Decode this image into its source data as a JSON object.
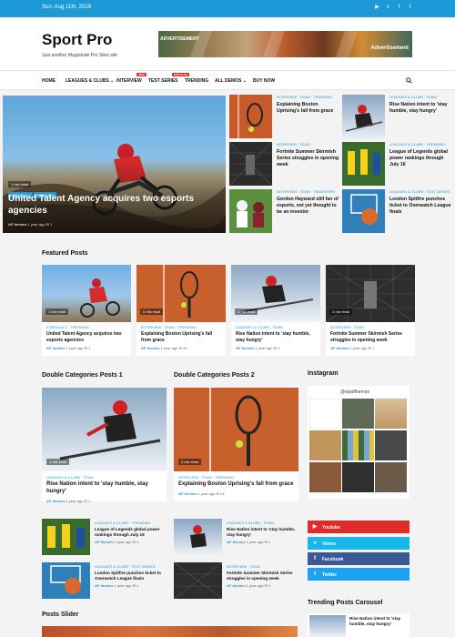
{
  "topbar": {
    "date": "Sun. Aug 11th, 2019",
    "icons": [
      "youtube-icon",
      "vimeo-icon",
      "facebook-icon",
      "twitter-icon"
    ]
  },
  "brand": {
    "title": "Sport Pro",
    "tagline": "Just another Magnitude Pro Sites site"
  },
  "ad": {
    "label_left": "ADVERTISEMENT",
    "label_right": "Advertisement"
  },
  "nav": [
    {
      "label": "HOME"
    },
    {
      "label": "LEAGUES & CLUBS",
      "dropdown": true
    },
    {
      "label": "INTERVIEW",
      "badge": "NEW",
      "badge_color": "#e02b2b"
    },
    {
      "label": "TEST SERIES",
      "badge": "POPULAR",
      "badge_color": "#e02b2b"
    },
    {
      "label": "TRENDING"
    },
    {
      "label": "ALL DEMOS",
      "dropdown": true
    },
    {
      "label": "BUY NOW"
    }
  ],
  "hero": {
    "read": "1 min read",
    "tags": [
      "FORMULA 2",
      "TRENDING"
    ],
    "title": "United Talent Agency acquires two esports agencies",
    "author": "AF themes",
    "ago": "1 year ago",
    "comments": "1"
  },
  "grid": [
    {
      "tags": "INTERVIEW · TEAM · TRENDING",
      "title": "Explaining Boston Uprising's fall from grace"
    },
    {
      "tags": "LEAGUES & CLUBS · TEAM",
      "title": "Rise Nation intent to 'stay humble, stay hungry'"
    },
    {
      "tags": "INTERVIEW · TEAM",
      "title": "Fortnite Summer Skirmish Series struggles in opening week"
    },
    {
      "tags": "LEAGUES & CLUBS · TRENDING",
      "title": "League of Legends global power rankings through July 16"
    },
    {
      "tags": "INTERVIEW · TEAM · TRANSFERS",
      "title": "Gordon Hayward still fan of esports, not yet thought to be an investor"
    },
    {
      "tags": "LEAGUES & CLUBS · TEST SERIES",
      "title": "London Spitfire punches ticket to Overwatch League finals"
    }
  ],
  "featured": {
    "title": "Featured Posts",
    "posts": [
      {
        "read": "1 min read",
        "tags": "FORMULA 2 · TRENDING",
        "title": "United Talent Agency acquires two esports agencies",
        "author": "AF themes",
        "ago": "1 year ago",
        "comments": "1"
      },
      {
        "read": "2 min read",
        "tags": "INTERVIEW · TEAM · TRENDING",
        "title": "Explaining Boston Uprising's fall from grace",
        "author": "AF themes",
        "ago": "1 year ago",
        "comments": "24"
      },
      {
        "read": "1 min read",
        "tags": "LEAGUES & CLUBS · TEAM",
        "title": "Rise Nation intent to 'stay humble, stay hungry'",
        "author": "AF themes",
        "ago": "1 year ago",
        "comments": "1"
      },
      {
        "read": "2 min read",
        "tags": "INTERVIEW · TEAM",
        "title": "Fortnite Summer Skirmish Series struggles in opening week",
        "author": "AF themes",
        "ago": "1 year ago",
        "comments": "1"
      }
    ]
  },
  "dc1": {
    "title": "Double Categories Posts 1",
    "main": {
      "read": "1 min read",
      "tags": "LEAGUES & CLUBS · TEAM",
      "title": "Rise Nation intent to 'stay humble, stay hungry'",
      "author": "AF themes",
      "ago": "1 year ago",
      "comments": "1"
    },
    "list": [
      {
        "tags": "LEAGUES & CLUBS · TRENDING",
        "title": "League of Legends global power rankings through July 16",
        "author": "AF themes",
        "ago": "1 year ago",
        "comments": "1"
      },
      {
        "tags": "LEAGUES & CLUBS · TEST SERIES",
        "title": "London Spitfire punches ticket to Overwatch League finals",
        "author": "AF themes",
        "ago": "1 year ago",
        "comments": "1"
      }
    ]
  },
  "dc2": {
    "title": "Double Categories Posts 2",
    "main": {
      "read": "2 min read",
      "tags": "INTERVIEW · TEAM · TRENDING",
      "title": "Explaining Boston Uprising's fall from grace",
      "author": "AF themes",
      "ago": "1 year ago",
      "comments": "24"
    },
    "list": [
      {
        "tags": "LEAGUES & CLUBS · TEAM",
        "title": "Rise Nation intent to 'stay humble, stay hungry'",
        "author": "AF themes",
        "ago": "1 year ago",
        "comments": "1"
      },
      {
        "tags": "INTERVIEW · TEAM",
        "title": "Fortnite Summer Skirmish Series struggles in opening week",
        "author": "AF themes",
        "ago": "1 year ago",
        "comments": "1"
      }
    ]
  },
  "instagram": {
    "title": "Instagram",
    "handle": "@wpafthemes"
  },
  "social": [
    {
      "label": "Youtube",
      "color": "#e02b2b",
      "icon": "youtube-icon"
    },
    {
      "label": "Vimeo",
      "color": "#1ab7ea",
      "icon": "vimeo-icon"
    },
    {
      "label": "Facebook",
      "color": "#3b5998",
      "icon": "facebook-icon"
    },
    {
      "label": "Twitter",
      "color": "#1da1f2",
      "icon": "twitter-icon"
    }
  ],
  "sections": {
    "slider": "Posts Slider",
    "carousel": "Trending Posts Carousel"
  },
  "colors": {
    "accent": "#1d9ad6"
  }
}
